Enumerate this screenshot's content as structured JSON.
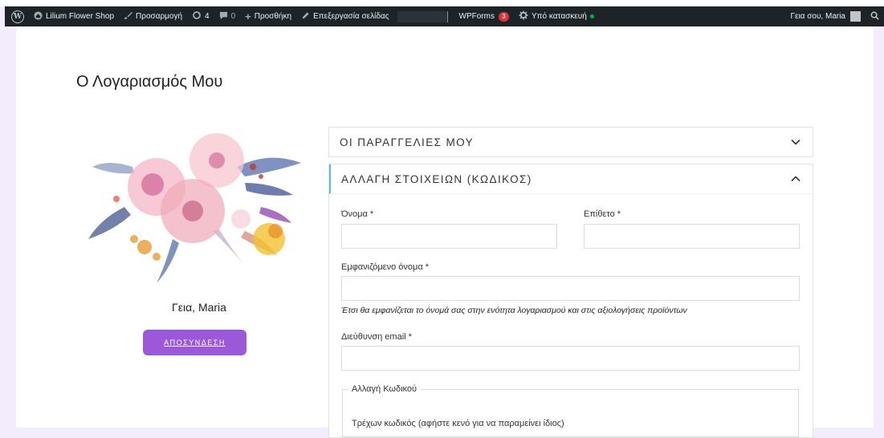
{
  "adminbar": {
    "site_name": "Lilium Flower Shop",
    "customize": "Προσαρμογή",
    "updates_count": "4",
    "comments_count": "0",
    "new_item": "Προσθήκη",
    "edit_page": "Επεξεργασία σελίδας",
    "wpforms": "WPForms",
    "wpforms_badge": "3",
    "maintenance": "Υπό κατασκευή",
    "howdy": "Γεια σου, Maria"
  },
  "page": {
    "title": "Ο Λογαριασμός Μου",
    "greeting": "Γεια, Maria",
    "logout_label": "ΑΠΟΣΥΝΔΕΣΗ"
  },
  "accordion": {
    "orders_label": "ΟΙ ΠΑΡΑΓΓΕΛΙΕΣ ΜΟΥ",
    "details_label": "ΑΛΛΑΓΗ ΣΤΟΙΧΕΙΩΝ (ΚΩΔΙΚΟΣ)"
  },
  "form": {
    "first_name_label": "Όνομα *",
    "first_name_value": "",
    "last_name_label": "Επίθετο *",
    "last_name_value": "",
    "display_name_label": "Εμφανιζόμενο όνομα *",
    "display_name_value": "",
    "display_name_hint": "Έτσι θα εμφανίζεται το όνομά σας στην ενότητα λογαριασμού και στις αξιολογήσεις προϊόντων",
    "email_label": "Διεύθυνση email *",
    "email_value": "",
    "password_legend": "Αλλαγή Κωδικού",
    "current_password_label": "Τρέχων κωδικός (αφήστε κενό για να παραμείνει ίδιος)"
  },
  "colors": {
    "adminbar_bg": "#1d2327",
    "accent_purple": "#9b59d9",
    "active_border": "#5bc0ce",
    "page_side_bg": "#f3ecfc"
  }
}
